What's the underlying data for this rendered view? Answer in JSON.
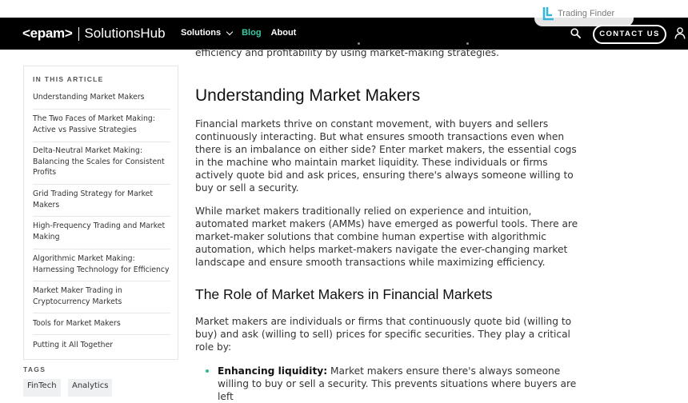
{
  "watermark": {
    "text": "Trading Finder"
  },
  "nav": {
    "brand_epam": "<epam>",
    "brand_hub": "SolutionsHub",
    "items": [
      {
        "label": "Solutions",
        "has_dropdown": true
      },
      {
        "label": "Blog",
        "active": true
      },
      {
        "label": "About"
      }
    ],
    "contact_label": "CONTACT US",
    "colors": {
      "background": "#000000",
      "active": "#38c9a6"
    }
  },
  "toc": {
    "title": "IN THIS ARTICLE",
    "items": [
      "Understanding Market Makers",
      "The Two Faces of Market Making: Active vs Passive Strategies",
      "Delta-Neutral Market Making: Balancing the Scales for Consistent Profits",
      "Grid Trading Strategy for Market Makers",
      "High-Frequency Trading and Market Making",
      "Algorithmic Market Making: Harnessing Technology for Efficiency",
      "Market Maker Trading in Cryptocurrency Markets",
      "Tools for Market Makers",
      "Putting it All Together"
    ]
  },
  "tags": {
    "title": "TAGS",
    "items": [
      "FinTech",
      "Analytics"
    ]
  },
  "article": {
    "clipped_text": "efficiency and profitability by using market-making strategies.",
    "heading1": "Understanding Market Makers",
    "para1": "Financial markets thrive on constant movement, with buyers and sellers continuously interacting. But what ensures smooth transactions even when there is an imbalance on either side? Enter market makers, the essential cogs in the machine who maintain market liquidity. These individuals or firms actively quote bid and ask prices, ensuring there's always someone willing to buy or sell a security.",
    "para2": "While market makers traditionally relied on experience and intuition, automated market makers (AMMs) have emerged as powerful tools. There are market-maker solutions that combine human expertise with algorithmic automation, which helps market-makers navigate the ever-changing market landscape and ensure smooth transactions while maximizing efficiency.",
    "heading2": "The Role of Market Makers in Financial Markets",
    "para3": "Market makers are individuals or firms that continuously quote bid (willing to buy) and ask (willing to sell) prices for specific securities. They play a critical role by:",
    "bullet1_bold": "Enhancing liquidity:",
    "bullet1_text": " Market makers ensure there's always someone willing to buy or sell a security. This prevents situations where buyers are left"
  }
}
